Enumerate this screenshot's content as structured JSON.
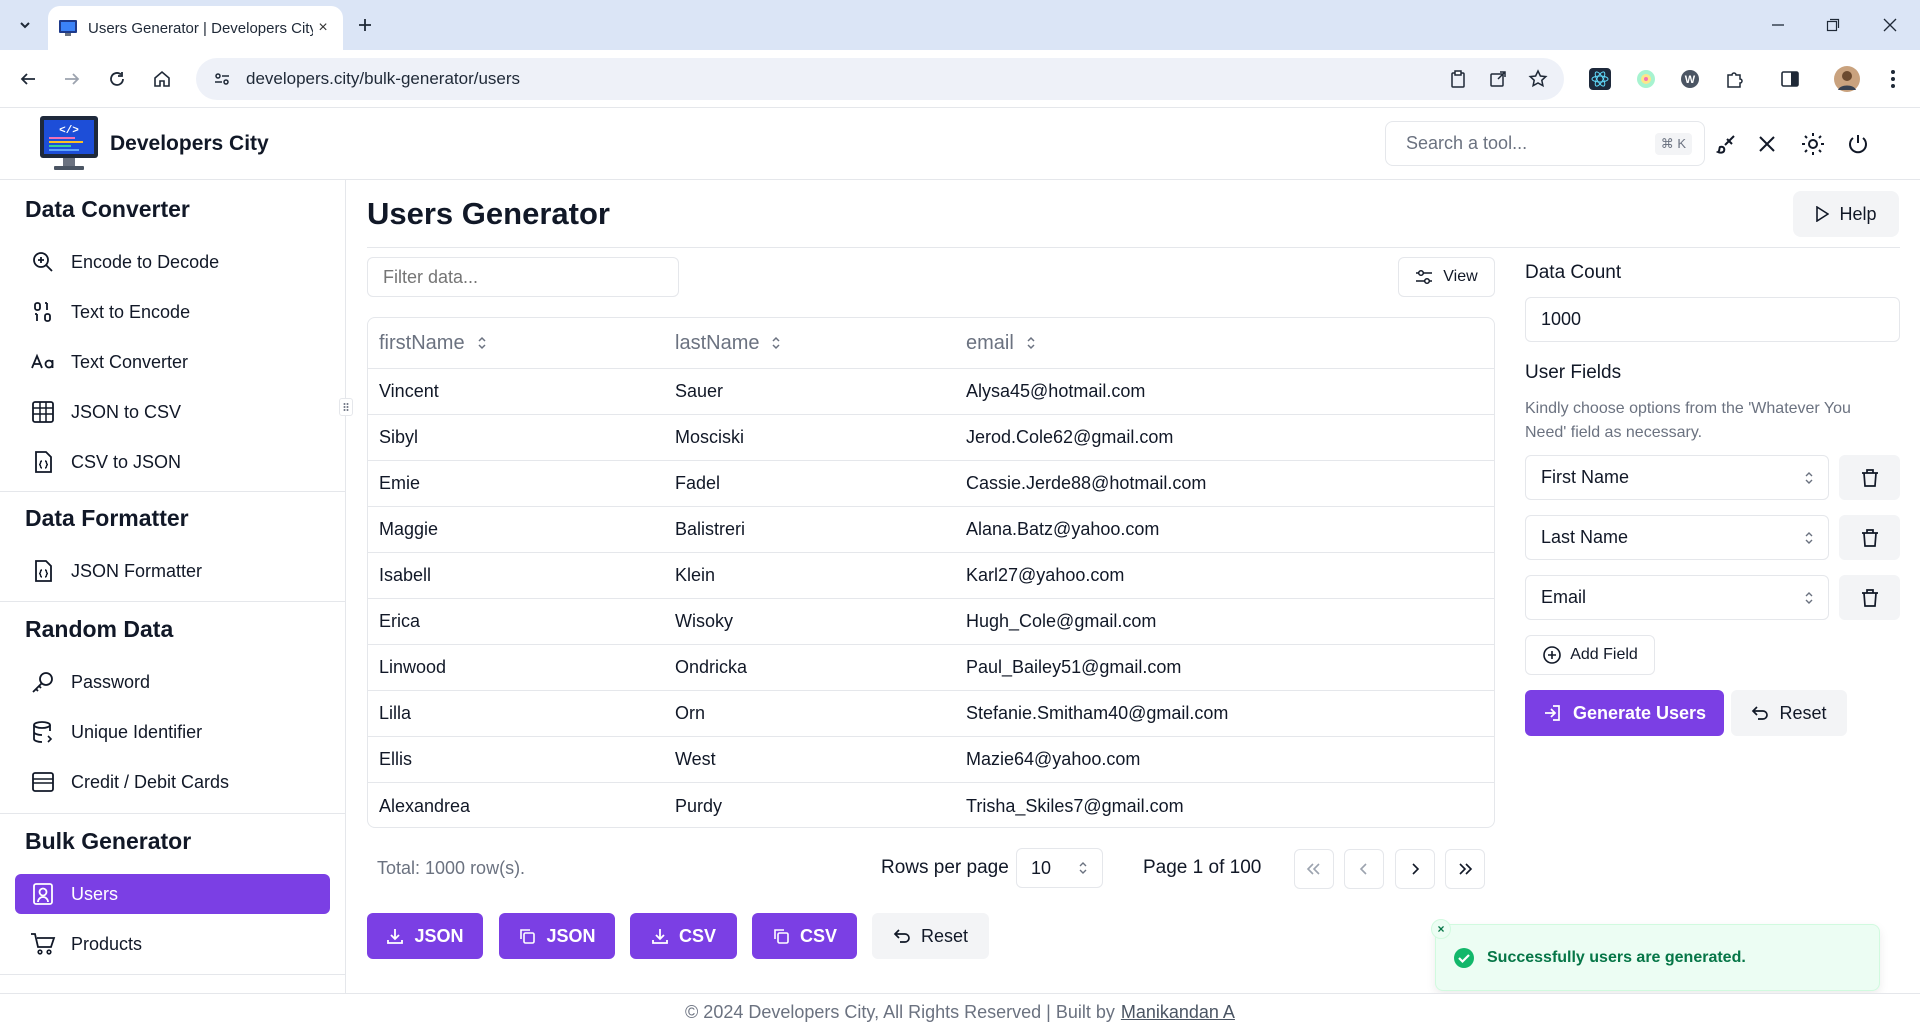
{
  "browser": {
    "tab_title": "Users Generator | Developers City",
    "url": "developers.city/bulk-generator/users",
    "new_tab": "+",
    "close_tab": "×"
  },
  "header": {
    "brand": "Developers City",
    "search_placeholder": "Search a tool...",
    "search_shortcut": "⌘ K"
  },
  "sidebar": {
    "sections": [
      {
        "title": "Data Converter",
        "items": [
          {
            "label": "Encode to Decode",
            "icon": "search-zoom-icon"
          },
          {
            "label": "Text to Encode",
            "icon": "binary-icon"
          },
          {
            "label": "Text Converter",
            "icon": "case-sensitive-icon"
          },
          {
            "label": "JSON to CSV",
            "icon": "table-icon"
          },
          {
            "label": "CSV to JSON",
            "icon": "file-json-icon"
          }
        ]
      },
      {
        "title": "Data Formatter",
        "items": [
          {
            "label": "JSON Formatter",
            "icon": "file-json-icon"
          }
        ]
      },
      {
        "title": "Random Data",
        "items": [
          {
            "label": "Password",
            "icon": "key-icon"
          },
          {
            "label": "Unique Identifier",
            "icon": "database-icon"
          },
          {
            "label": "Credit / Debit Cards",
            "icon": "wallet-icon"
          }
        ]
      },
      {
        "title": "Bulk Generator",
        "items": [
          {
            "label": "Users",
            "icon": "user-square-icon",
            "active": true
          },
          {
            "label": "Products",
            "icon": "shopping-cart-icon"
          }
        ]
      }
    ]
  },
  "main": {
    "title": "Users Generator",
    "help_label": "Help",
    "filter_placeholder": "Filter data...",
    "view_label": "View",
    "table": {
      "columns": [
        "firstName",
        "lastName",
        "email"
      ],
      "rows": [
        [
          "Vincent",
          "Sauer",
          "Alysa45@hotmail.com"
        ],
        [
          "Sibyl",
          "Mosciski",
          "Jerod.Cole62@gmail.com"
        ],
        [
          "Emie",
          "Fadel",
          "Cassie.Jerde88@hotmail.com"
        ],
        [
          "Maggie",
          "Balistreri",
          "Alana.Batz@yahoo.com"
        ],
        [
          "Isabell",
          "Klein",
          "Karl27@yahoo.com"
        ],
        [
          "Erica",
          "Wisoky",
          "Hugh_Cole@gmail.com"
        ],
        [
          "Linwood",
          "Ondricka",
          "Paul_Bailey51@gmail.com"
        ],
        [
          "Lilla",
          "Orn",
          "Stefanie.Smitham40@gmail.com"
        ],
        [
          "Ellis",
          "West",
          "Mazie64@yahoo.com"
        ],
        [
          "Alexandrea",
          "Purdy",
          "Trisha_Skiles7@gmail.com"
        ]
      ]
    },
    "pagination": {
      "total": "Total: 1000 row(s).",
      "rows_per_page_label": "Rows per page",
      "rows_per_page": "10",
      "page_info": "Page 1 of 100"
    },
    "actions": {
      "download_json": "JSON",
      "copy_json": "JSON",
      "download_csv": "CSV",
      "copy_csv": "CSV",
      "reset": "Reset"
    }
  },
  "panel": {
    "data_count_label": "Data Count",
    "data_count": "1000",
    "user_fields_label": "User Fields",
    "hint": "Kindly choose options from the 'Whatever You Need' field as necessary.",
    "fields": [
      "First Name",
      "Last Name",
      "Email"
    ],
    "add_field": "Add Field",
    "generate": "Generate Users",
    "reset": "Reset"
  },
  "toast": {
    "message": "Successfully users are generated.",
    "close": "×"
  },
  "footer": {
    "text": "© 2024 Developers City, All Rights Reserved | Built by",
    "author": "Manikandan A"
  },
  "colors": {
    "accent": "#7b3fe4",
    "success": "#067647",
    "tabbar": "#dbe5f6"
  }
}
